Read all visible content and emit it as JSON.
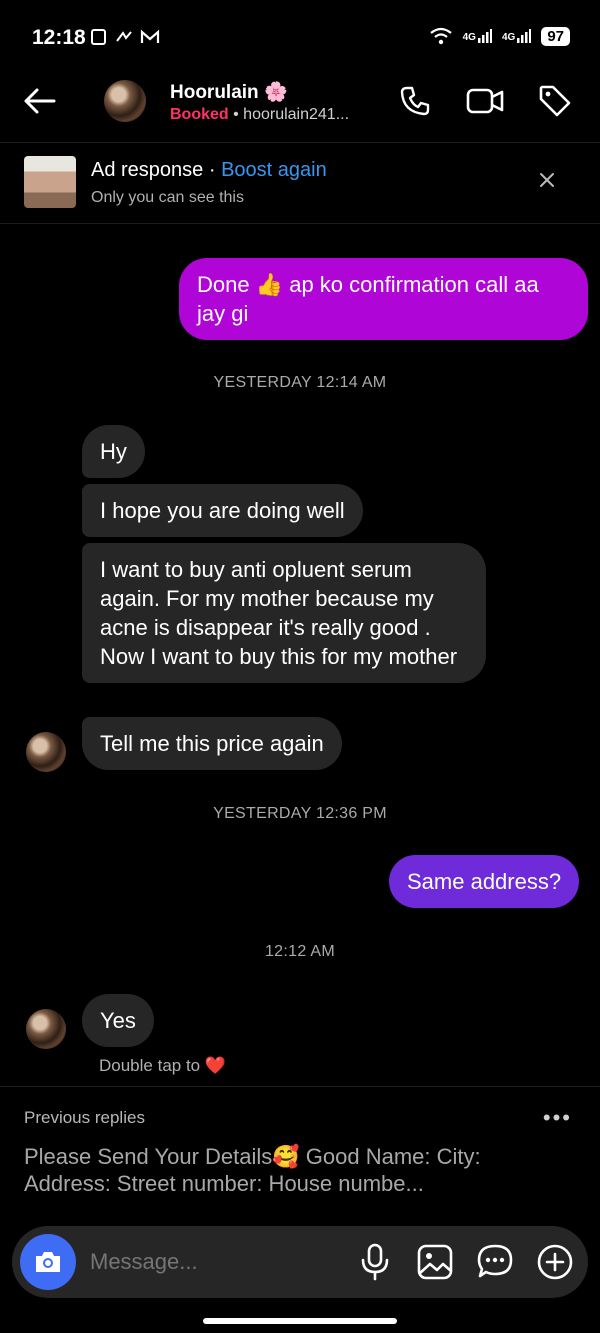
{
  "status_bar": {
    "time": "12:18",
    "network_1": "4G",
    "network_2": "4G",
    "battery": "97"
  },
  "header": {
    "name": "Hoorulain",
    "name_emoji": "🌸",
    "status": "Booked",
    "separator": " • ",
    "username": "hoorulain241..."
  },
  "ad": {
    "title": "Ad response",
    "separator": " · ",
    "boost_label": "Boost again",
    "subtitle": "Only you can see this"
  },
  "messages": {
    "m1": "Done 👍 ap ko confirmation call aa jay gi",
    "ts1": "YESTERDAY 12:14 AM",
    "m2": "Hy",
    "m3": "I hope you are doing well",
    "m4": "I want to buy anti opluent serum again. For my mother because my acne is disappear it's really good . Now I want to buy this for my mother",
    "m5": "Tell me this price again",
    "ts2": "YESTERDAY 12:36 PM",
    "m6": "Same address?",
    "ts3": "12:12 AM",
    "m7": "Yes",
    "hint": "Double tap to",
    "hint_heart": "❤️"
  },
  "previous_replies": {
    "title": "Previous replies",
    "more": "•••",
    "text": "Please Send Your Details🥰 Good Name: City: Address: Street number: House numbe..."
  },
  "composer": {
    "placeholder": "Message..."
  },
  "colors": {
    "outgoing": "#b005d7",
    "outgoing_alt": "#6f2bd9",
    "incoming": "#262626",
    "booked": "#ff3264",
    "link": "#3797f0",
    "camera": "#3e6cf5"
  }
}
